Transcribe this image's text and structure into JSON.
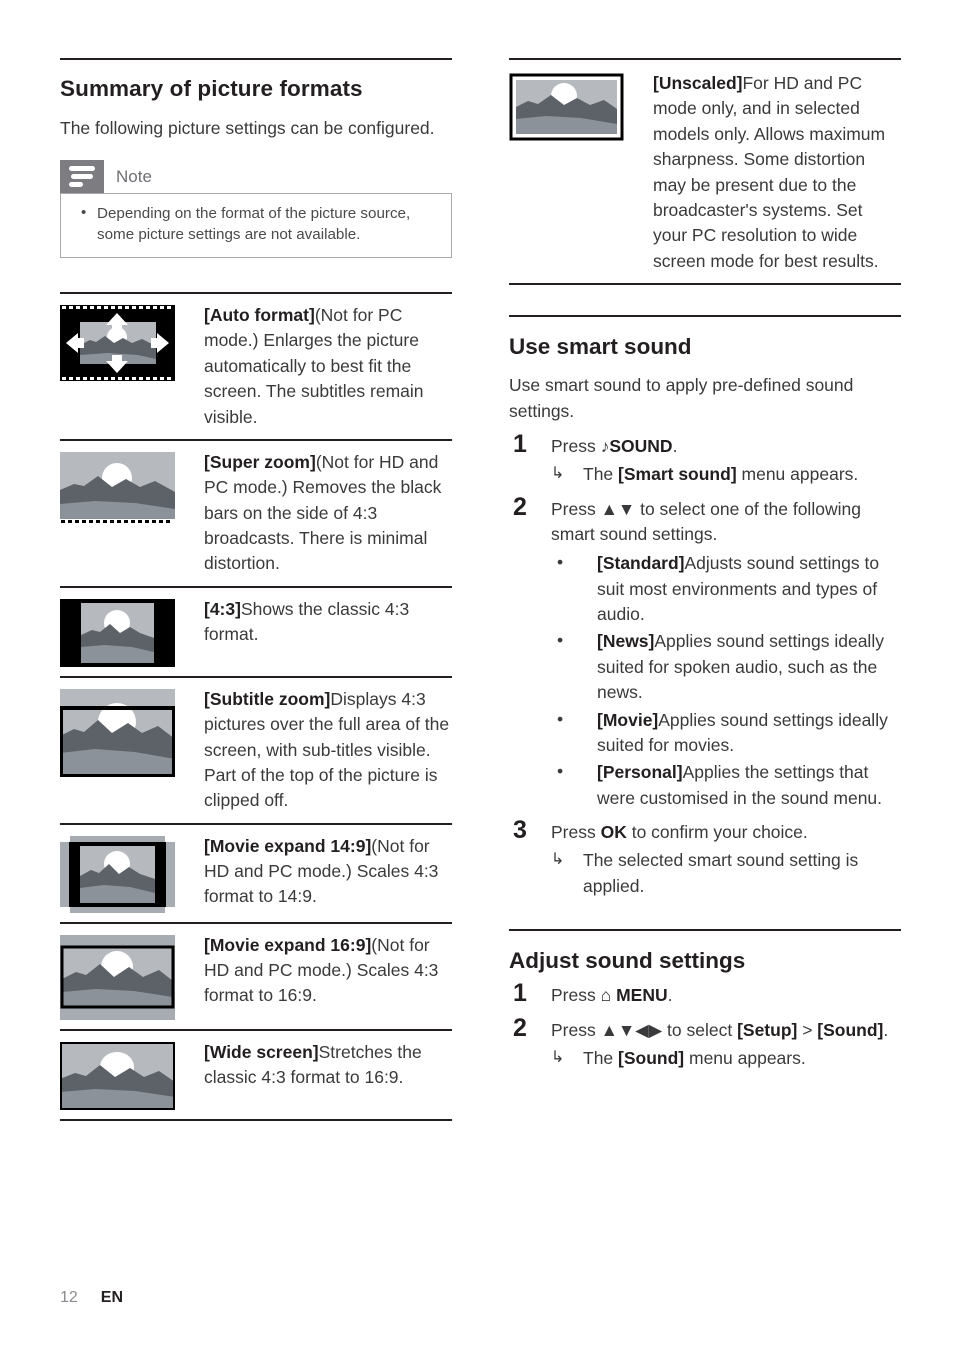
{
  "document": {
    "page_number": "12",
    "language_code": "EN"
  },
  "left_column": {
    "heading": "Summary of picture formats",
    "intro": "The following picture settings can be configured.",
    "note": {
      "label": "Note",
      "icon": "note-lines-icon",
      "bullets": [
        "Depending on the format of the picture source, some picture settings are not available."
      ]
    },
    "formats": [
      {
        "thumb": "auto-format-thumbnail",
        "term": "[Auto format]",
        "desc": "(Not for PC mode.) Enlarges the picture automatically to best fit the screen. The subtitles remain visible."
      },
      {
        "thumb": "super-zoom-thumbnail",
        "term": "[Super zoom]",
        "desc": "(Not for HD and PC mode.) Removes the black bars on the side of 4:3 broadcasts. There is minimal distortion."
      },
      {
        "thumb": "four-three-thumbnail",
        "term": "[4:3]",
        "desc": "Shows the classic 4:3 format."
      },
      {
        "thumb": "subtitle-zoom-thumbnail",
        "term": "[Subtitle zoom]",
        "desc": "Displays 4:3 pictures over the full area of the screen, with sub-titles visible. Part of the top of the picture is clipped off."
      },
      {
        "thumb": "movie-expand-14-9-thumbnail",
        "term": "[Movie expand 14:9]",
        "desc": "(Not for HD and PC mode.) Scales 4:3 format to 14:9."
      },
      {
        "thumb": "movie-expand-16-9-thumbnail",
        "term": "[Movie expand 16:9]",
        "desc": "(Not for HD and PC mode.) Scales 4:3 format to 16:9."
      },
      {
        "thumb": "wide-screen-thumbnail",
        "term": "[Wide screen]",
        "desc": "Stretches the classic 4:3 format to 16:9."
      }
    ]
  },
  "right_column": {
    "unscaled": {
      "thumb": "unscaled-thumbnail",
      "term": "[Unscaled]",
      "desc": "For HD and PC mode only, and in selected models only. Allows maximum sharpness. Some distortion may be present due to the broadcaster's systems. Set your PC resolution to wide screen mode for best results."
    },
    "smart_sound": {
      "heading": "Use smart sound",
      "intro": "Use smart sound to apply pre-defined sound settings.",
      "step1": {
        "num": "1",
        "text_before": "Press ",
        "icon": "♪",
        "key": "SOUND",
        "text_after": ".",
        "result_arrow": "↳",
        "result_before": "The ",
        "result_term": "[Smart sound]",
        "result_after": " menu appears."
      },
      "step2": {
        "num": "2",
        "text": "Press ▲▼ to select one of the following smart sound settings.",
        "options": [
          {
            "term": "[Standard]",
            "desc": "Adjusts sound settings to suit most environments and types of audio."
          },
          {
            "term": "[News]",
            "desc": "Applies sound settings ideally suited for spoken audio, such as the news."
          },
          {
            "term": "[Movie]",
            "desc": "Applies sound settings ideally suited for movies."
          },
          {
            "term": "[Personal]",
            "desc": "Applies the settings that were customised in the sound menu."
          }
        ]
      },
      "step3": {
        "num": "3",
        "text_before": "Press ",
        "key": "OK",
        "text_after": " to confirm your choice.",
        "result_arrow": "↳",
        "result": "The selected smart sound setting is applied."
      }
    },
    "adjust_sound": {
      "heading": "Adjust sound settings",
      "step1": {
        "num": "1",
        "text_before": "Press ",
        "icon": "⌂",
        "key": "MENU",
        "text_after": "."
      },
      "step2": {
        "num": "2",
        "text_before": "Press ▲▼◀▶ to select ",
        "term1": "[Setup]",
        "separator": " > ",
        "term2": "[Sound]",
        "text_after": ".",
        "result_arrow": "↳",
        "result_before": "The ",
        "result_term": "[Sound]",
        "result_after": " menu appears."
      }
    }
  }
}
